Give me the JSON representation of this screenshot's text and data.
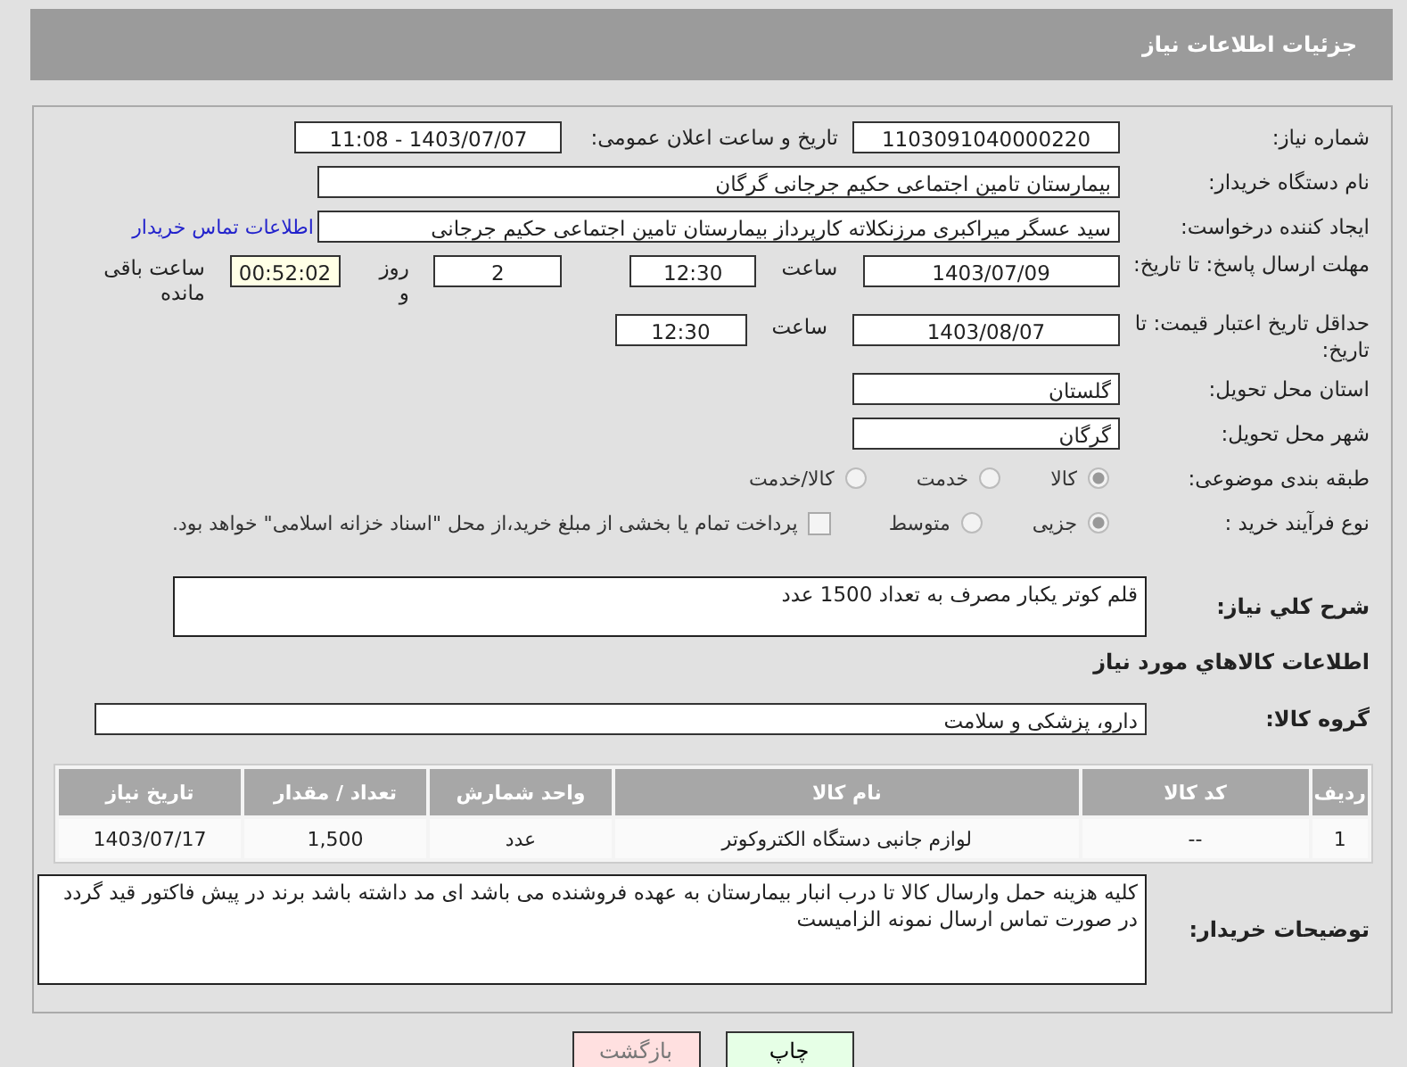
{
  "page_title": "جزئیات اطلاعات نیاز",
  "fields": {
    "need_number": {
      "label": "شماره نیاز:",
      "value": "1103091040000220"
    },
    "announce": {
      "label": "تاریخ و ساعت اعلان عمومی:",
      "value": "1403/07/07 - 11:08"
    },
    "buyer": {
      "label": "نام دستگاه خریدار:",
      "value": "بیمارستان تامین اجتماعی حکیم جرجانی گرگان"
    },
    "creator": {
      "label": "ایجاد کننده درخواست:",
      "value": "سید عسگر میراکبری مرزنکلاته کارپرداز بیمارستان تامین اجتماعی حکیم جرجانی",
      "link": "اطلاعات تماس خریدار"
    },
    "deadline": {
      "label": "مهلت ارسال پاسخ: تا تاریخ:",
      "date": "1403/07/09",
      "time_label": "ساعت",
      "time": "12:30",
      "days": "2",
      "days_label": "روز و",
      "remaining": "00:52:02",
      "remaining_label": "ساعت باقی مانده"
    },
    "validity": {
      "label": "حداقل تاریخ اعتبار قیمت: تا تاریخ:",
      "date": "1403/08/07",
      "time_label": "ساعت",
      "time": "12:30"
    },
    "province": {
      "label": "استان محل تحویل:",
      "value": "گلستان"
    },
    "city": {
      "label": "شهر محل تحویل:",
      "value": "گرگان"
    }
  },
  "category": {
    "label": "طبقه بندی موضوعی:",
    "options": [
      {
        "label": "کالا",
        "selected": true
      },
      {
        "label": "خدمت",
        "selected": false
      },
      {
        "label": "کالا/خدمت",
        "selected": false
      }
    ]
  },
  "process": {
    "label": "نوع فرآیند خرید :",
    "options": [
      {
        "label": "جزیی",
        "selected": true
      },
      {
        "label": "متوسط",
        "selected": false
      }
    ],
    "treasury": {
      "checked": false,
      "label": "پرداخت تمام یا بخشی از مبلغ خرید،از محل \"اسناد خزانه اسلامی\" خواهد بود."
    }
  },
  "description": {
    "label": "شرح کلي نياز:",
    "value": "قلم کوتر یکبار مصرف به تعداد 1500 عدد"
  },
  "goods_heading": "اطلاعات کالاهاي مورد نياز",
  "goods_group": {
    "label": "گروه کالا:",
    "value": "دارو، پزشکی و سلامت"
  },
  "table": {
    "columns": [
      "ردیف",
      "کد کالا",
      "نام کالا",
      "واحد شمارش",
      "تعداد / مقدار",
      "تاریخ نیاز"
    ],
    "rows": [
      [
        "1",
        "--",
        "لوازم جانبی دستگاه الکتروکوتر",
        "عدد",
        "1,500",
        "1403/07/17"
      ]
    ]
  },
  "buyer_notes": {
    "label": "توضیحات خریدار:",
    "value": "کلیه هزینه حمل وارسال کالا تا درب انبار بیمارستان به عهده فروشنده می باشد ای مد داشته باشد برند در پیش فاکتور قید گردد در صورت تماس ارسال نمونه الزامیست"
  },
  "buttons": [
    {
      "kind": "print",
      "label": "چاپ"
    },
    {
      "kind": "back",
      "label": "بازگشت"
    }
  ]
}
